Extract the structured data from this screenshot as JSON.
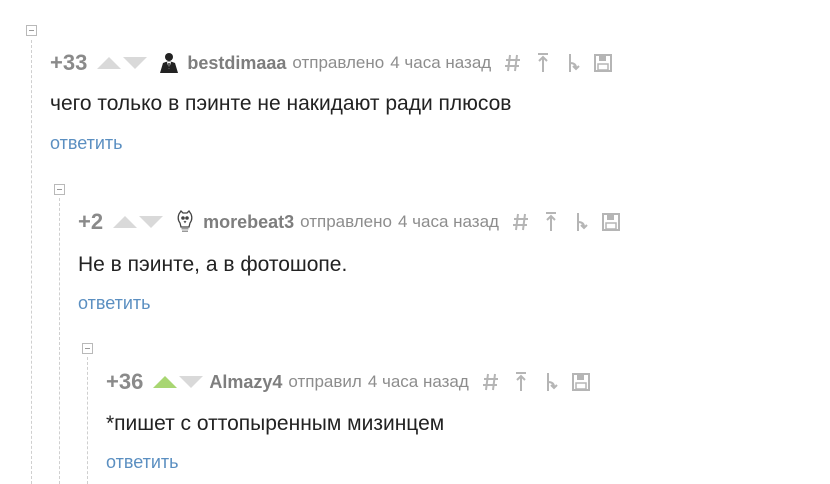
{
  "comments": [
    {
      "rating": "+33",
      "username": "bestdimaaa",
      "action": "отправлено",
      "time": "4 часа назад",
      "text": "чего только в пэинте не накидают ради плюсов",
      "reply_label": "ответить",
      "avatar_icon": "man-in-suit-icon",
      "upvoted": false
    },
    {
      "rating": "+2",
      "username": "morebeat3",
      "action": "отправлено",
      "time": "4 часа назад",
      "text": "Не в пэинте, а в фотошопе.",
      "reply_label": "ответить",
      "avatar_icon": "lightbulb-owl-icon",
      "upvoted": false
    },
    {
      "rating": "+36",
      "username": "Almazy4",
      "action": "отправил",
      "time": "4 часа назад",
      "text": "*пишет с оттопыренным мизинцем",
      "reply_label": "ответить",
      "avatar_icon": "none",
      "upvoted": true
    }
  ],
  "tool_icons": [
    "hash-link-icon",
    "go-to-parent-icon",
    "branch-icon",
    "save-icon"
  ],
  "colors": {
    "rating": "#8a8a8a",
    "reply_link": "#5b8fc1",
    "upvote_active": "#a8d672",
    "vote_inactive": "#d9d9d9"
  }
}
